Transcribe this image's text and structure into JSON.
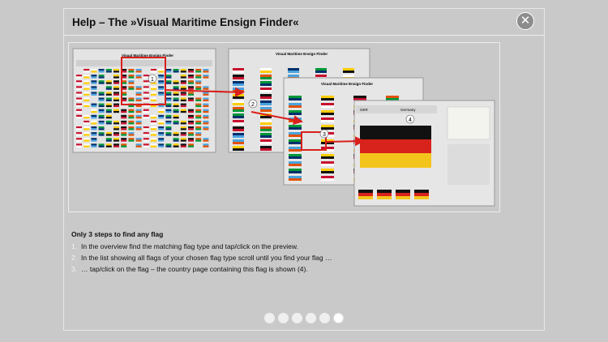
{
  "header": {
    "title": "Help – The »Visual Maritime Ensign Finder«",
    "close_icon": "close-icon"
  },
  "screens": {
    "overview_title": "Visual Maritime Ensign Finder",
    "list_title_1": "Visual Maritime Ensign Finder",
    "list_title_2": "Visual Maritime Ensign Finder",
    "country_code": "GER",
    "country_name": "Germany",
    "markers": [
      "1",
      "2",
      "3",
      "4"
    ]
  },
  "steps": {
    "heading": "Only 3 steps to find any flag",
    "items": [
      {
        "num": "1.",
        "text": "In the overview find the matching flag type and tap/click on the preview."
      },
      {
        "num": "2.",
        "text": "In the list showing all flags of your chosen flag type scroll until you find your flag …"
      },
      {
        "num": "3.",
        "text": "… tap/click on the flag – the country page containing this flag is shown (4)."
      }
    ]
  },
  "pager": {
    "count": 6,
    "active_index": 5
  },
  "colors": {
    "arrow": "#d9201b",
    "background": "#c9c9c9"
  }
}
